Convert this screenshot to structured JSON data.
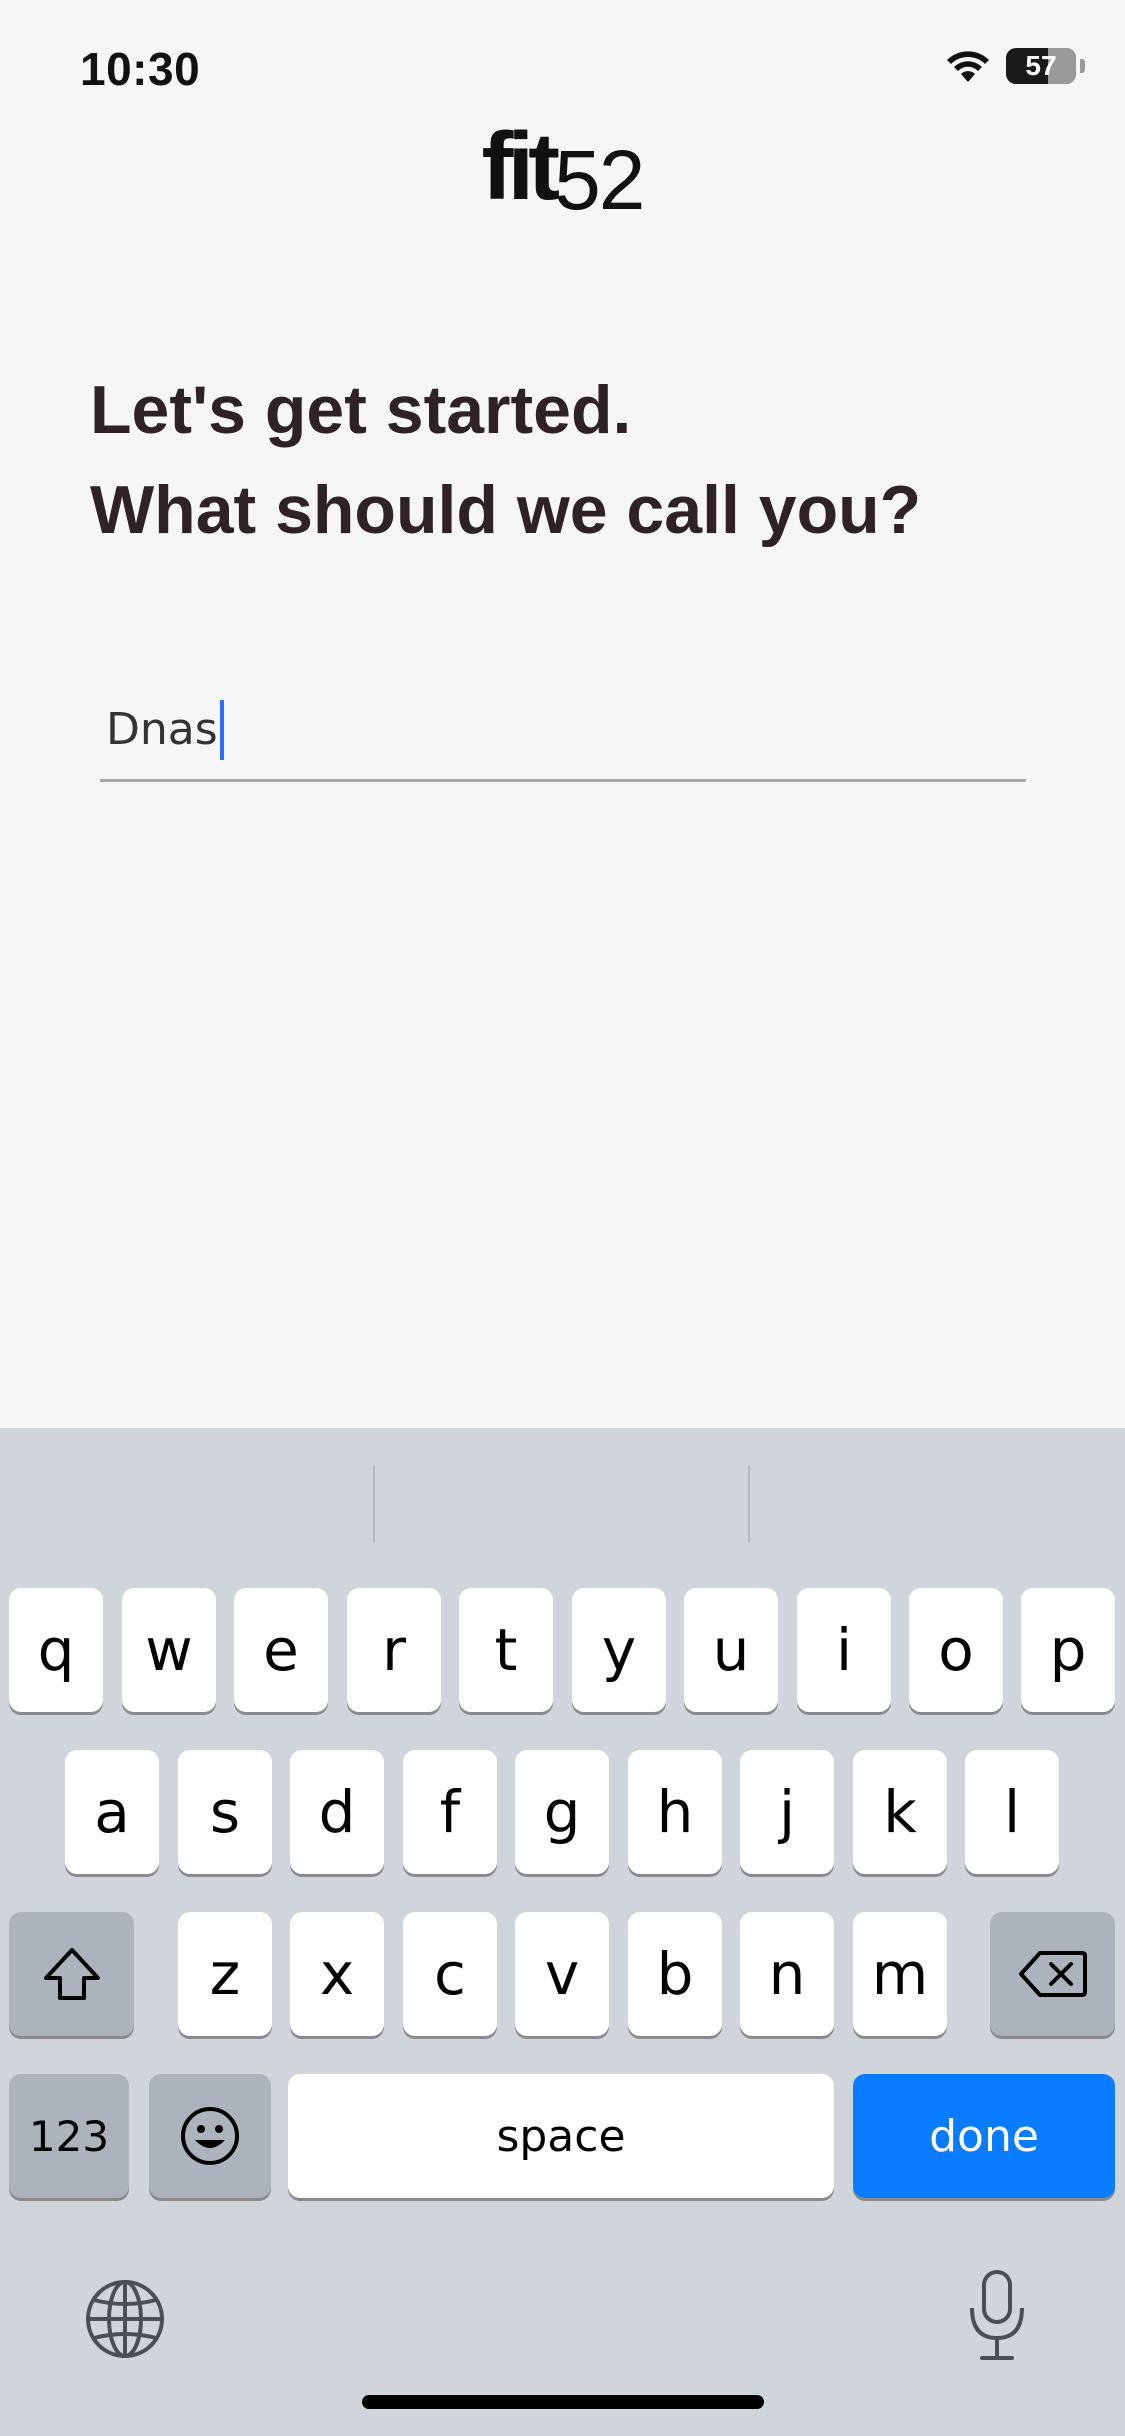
{
  "status_bar": {
    "time": "10:30",
    "battery_level": "57"
  },
  "logo": {
    "word": "fit",
    "number": "52"
  },
  "heading": {
    "line1": "Let's get started.",
    "line2": "What should we call you?"
  },
  "name_input": {
    "value": "Dnas"
  },
  "keyboard": {
    "row1": [
      "q",
      "w",
      "e",
      "r",
      "t",
      "y",
      "u",
      "i",
      "o",
      "p"
    ],
    "row2": [
      "a",
      "s",
      "d",
      "f",
      "g",
      "h",
      "j",
      "k",
      "l"
    ],
    "row3": [
      "z",
      "x",
      "c",
      "v",
      "b",
      "n",
      "m"
    ],
    "numbers_label": "123",
    "space_label": "space",
    "done_label": "done",
    "icons": {
      "shift": "shift-icon",
      "delete": "backspace-icon",
      "emoji": "emoji-icon",
      "globe": "globe-icon",
      "mic": "microphone-icon"
    },
    "colors": {
      "done_key": "#0a7cff",
      "caret": "#2f6bff"
    }
  }
}
